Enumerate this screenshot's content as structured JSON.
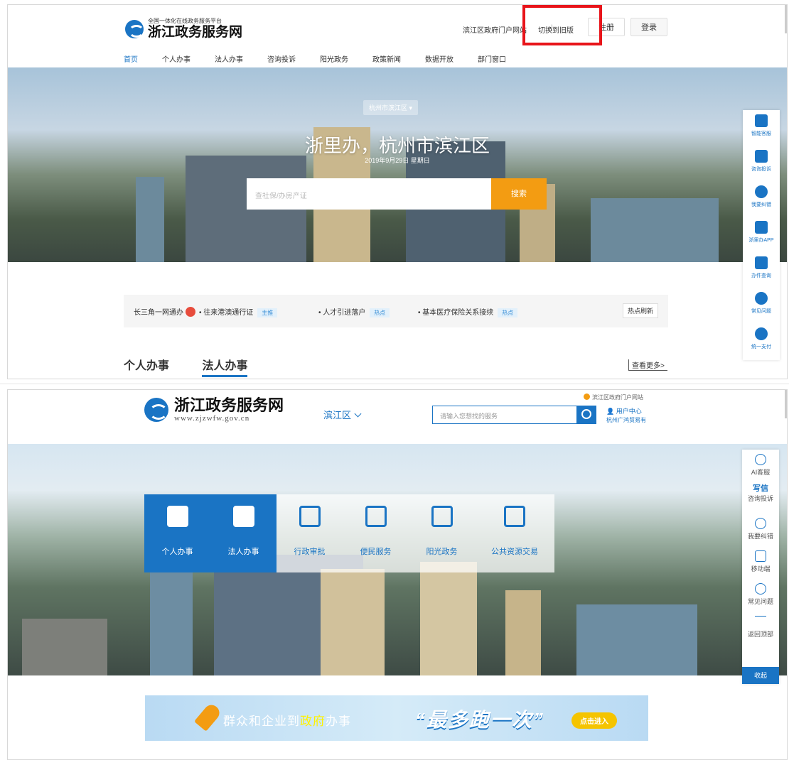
{
  "screen1": {
    "logo": {
      "subtitle": "全国一体化在线政务服务平台",
      "title": "浙江政务服务网"
    },
    "header": {
      "portal_link": "滨江区政府门户网站",
      "switch_old": "切换到旧版",
      "register": "注册",
      "login": "登录"
    },
    "nav": [
      "首页",
      "个人办事",
      "法人办事",
      "咨询投诉",
      "阳光政务",
      "政策新闻",
      "数据开放",
      "部门窗口"
    ],
    "banner": {
      "city_select": "杭州市滨江区",
      "headline": "浙里办，杭州市滨江区",
      "date": "2019年9月29日 星期日",
      "search_placeholder": "查社保/办房产证",
      "search_button": "搜索"
    },
    "hot": {
      "item0": "长三角一网通办",
      "item1": "• 往来港澳通行证",
      "tag1": "主推",
      "item2": "• 人才引进落户",
      "tag2": "热点",
      "item3": "• 基本医疗保险关系接续",
      "tag3": "热点",
      "refresh": "热点刷新"
    },
    "tabs": [
      "个人办事",
      "法人办事"
    ],
    "more": "查看更多>",
    "side": [
      "智能客服",
      "咨询投诉",
      "我要纠错",
      "浙里办APP",
      "办件查询",
      "常见问题",
      "统一支付"
    ]
  },
  "screen2": {
    "logo": {
      "title": "浙江政务服务网",
      "url": "www.zjzwfw.gov.cn"
    },
    "region": "滨江区",
    "search_placeholder": "请输入您想找的服务",
    "portal_link": "滨江区政府门户网站",
    "user_center": "用户中心",
    "user_name": "杭州广鸿贸易有",
    "services": [
      "个人办事",
      "法人办事",
      "行政审批",
      "便民服务",
      "阳光政务",
      "公共资源交易"
    ],
    "ad": {
      "text_a": "群众和企业到",
      "text_b": "政府",
      "text_c": "办事",
      "big": "“最多跑一次”",
      "button": "点击进入"
    },
    "side": [
      "AI客服",
      "写信",
      "咨询投诉",
      "我要纠错",
      "移动端",
      "常见问题",
      "返回顶部"
    ],
    "collapse": "收起"
  },
  "colors": {
    "primary": "#1a74c4",
    "accent_orange": "#f39c12",
    "highlight_red": "#e8141a"
  }
}
